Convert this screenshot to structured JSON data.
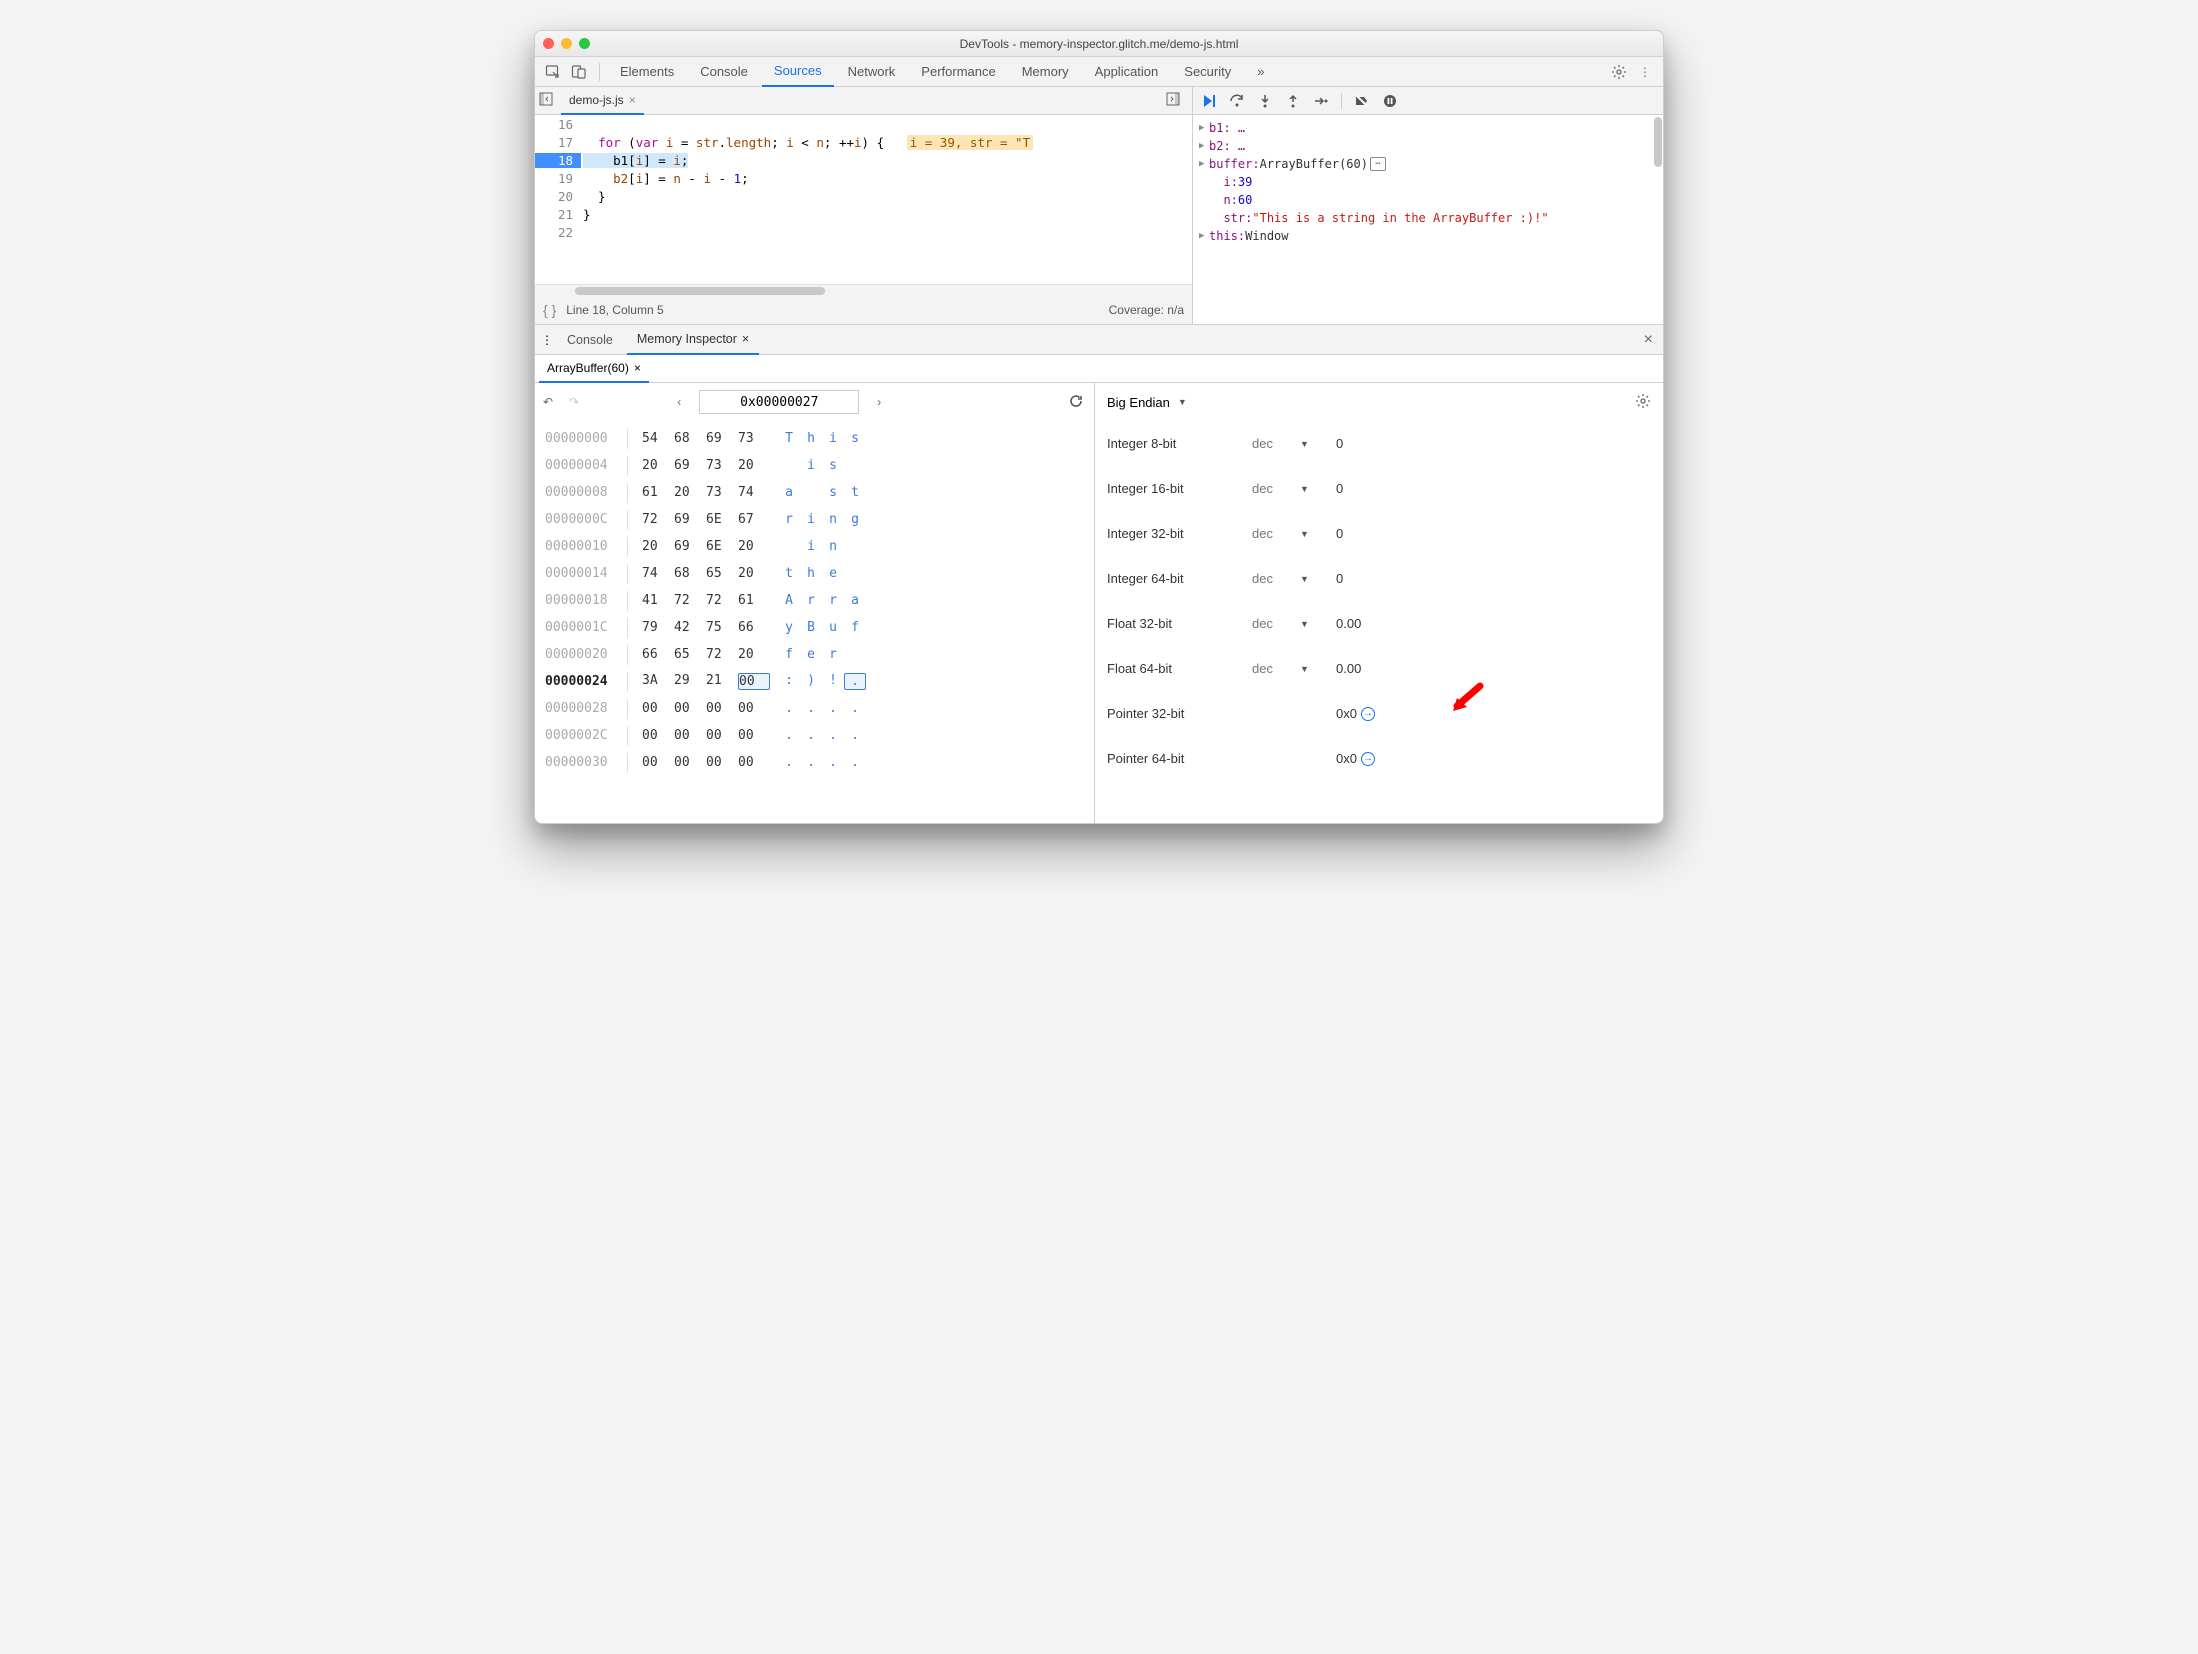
{
  "window": {
    "title": "DevTools - memory-inspector.glitch.me/demo-js.html"
  },
  "mainTabs": [
    "Elements",
    "Console",
    "Sources",
    "Network",
    "Performance",
    "Memory",
    "Application",
    "Security"
  ],
  "mainTabActive": "Sources",
  "sourceTab": {
    "name": "demo-js.js"
  },
  "code": {
    "lines": [
      {
        "n": "16",
        "t": ""
      },
      {
        "n": "17",
        "t": "  for (var i = str.length; i < n; ++i) {   "
      },
      {
        "n": "18",
        "t": "    b1[i] = i;"
      },
      {
        "n": "19",
        "t": "    b2[i] = n - i - 1;"
      },
      {
        "n": "20",
        "t": "  }"
      },
      {
        "n": "21",
        "t": "}"
      },
      {
        "n": "22",
        "t": ""
      }
    ],
    "inlineHint": "i = 39, str = \"T"
  },
  "status": {
    "pos": "Line 18, Column 5",
    "coverage": "Coverage: n/a"
  },
  "scope": {
    "b1": "b1: …",
    "b2": "b2: …",
    "buffer_label": "buffer",
    "buffer_val": "ArrayBuffer(60)",
    "i_label": "i",
    "i_val": "39",
    "n_label": "n",
    "n_val": "60",
    "str_label": "str",
    "str_val": "\"This is a string in the ArrayBuffer :)!\"",
    "this_label": "this",
    "this_val": "Window"
  },
  "drawer": {
    "tabs": [
      "Console",
      "Memory Inspector"
    ],
    "active": "Memory Inspector"
  },
  "inspector": {
    "tab": "ArrayBuffer(60)",
    "address": "0x00000027",
    "endian": "Big Endian",
    "rows": [
      {
        "addr": "00000000",
        "b": [
          "54",
          "68",
          "69",
          "73"
        ],
        "a": [
          "T",
          "h",
          "i",
          "s"
        ]
      },
      {
        "addr": "00000004",
        "b": [
          "20",
          "69",
          "73",
          "20"
        ],
        "a": [
          " ",
          "i",
          "s",
          " "
        ]
      },
      {
        "addr": "00000008",
        "b": [
          "61",
          "20",
          "73",
          "74"
        ],
        "a": [
          "a",
          " ",
          "s",
          "t"
        ]
      },
      {
        "addr": "0000000C",
        "b": [
          "72",
          "69",
          "6E",
          "67"
        ],
        "a": [
          "r",
          "i",
          "n",
          "g"
        ]
      },
      {
        "addr": "00000010",
        "b": [
          "20",
          "69",
          "6E",
          "20"
        ],
        "a": [
          " ",
          "i",
          "n",
          " "
        ]
      },
      {
        "addr": "00000014",
        "b": [
          "74",
          "68",
          "65",
          "20"
        ],
        "a": [
          "t",
          "h",
          "e",
          " "
        ]
      },
      {
        "addr": "00000018",
        "b": [
          "41",
          "72",
          "72",
          "61"
        ],
        "a": [
          "A",
          "r",
          "r",
          "a"
        ]
      },
      {
        "addr": "0000001C",
        "b": [
          "79",
          "42",
          "75",
          "66"
        ],
        "a": [
          "y",
          "B",
          "u",
          "f"
        ]
      },
      {
        "addr": "00000020",
        "b": [
          "66",
          "65",
          "72",
          "20"
        ],
        "a": [
          "f",
          "e",
          "r",
          " "
        ]
      },
      {
        "addr": "00000024",
        "b": [
          "3A",
          "29",
          "21",
          "00"
        ],
        "a": [
          ":",
          ")",
          "!",
          "."
        ],
        "bold": true,
        "sel": 3
      },
      {
        "addr": "00000028",
        "b": [
          "00",
          "00",
          "00",
          "00"
        ],
        "a": [
          ".",
          ".",
          ".",
          "."
        ]
      },
      {
        "addr": "0000002C",
        "b": [
          "00",
          "00",
          "00",
          "00"
        ],
        "a": [
          ".",
          ".",
          ".",
          "."
        ]
      },
      {
        "addr": "00000030",
        "b": [
          "00",
          "00",
          "00",
          "00"
        ],
        "a": [
          ".",
          ".",
          ".",
          "."
        ]
      }
    ],
    "values": [
      {
        "label": "Integer 8-bit",
        "mode": "dec",
        "val": "0"
      },
      {
        "label": "Integer 16-bit",
        "mode": "dec",
        "val": "0"
      },
      {
        "label": "Integer 32-bit",
        "mode": "dec",
        "val": "0"
      },
      {
        "label": "Integer 64-bit",
        "mode": "dec",
        "val": "0"
      },
      {
        "label": "Float 32-bit",
        "mode": "dec",
        "val": "0.00"
      },
      {
        "label": "Float 64-bit",
        "mode": "dec",
        "val": "0.00"
      },
      {
        "label": "Pointer 32-bit",
        "mode": "",
        "val": "0x0",
        "jump": true,
        "arrow": true
      },
      {
        "label": "Pointer 64-bit",
        "mode": "",
        "val": "0x0",
        "jump": true
      }
    ]
  }
}
